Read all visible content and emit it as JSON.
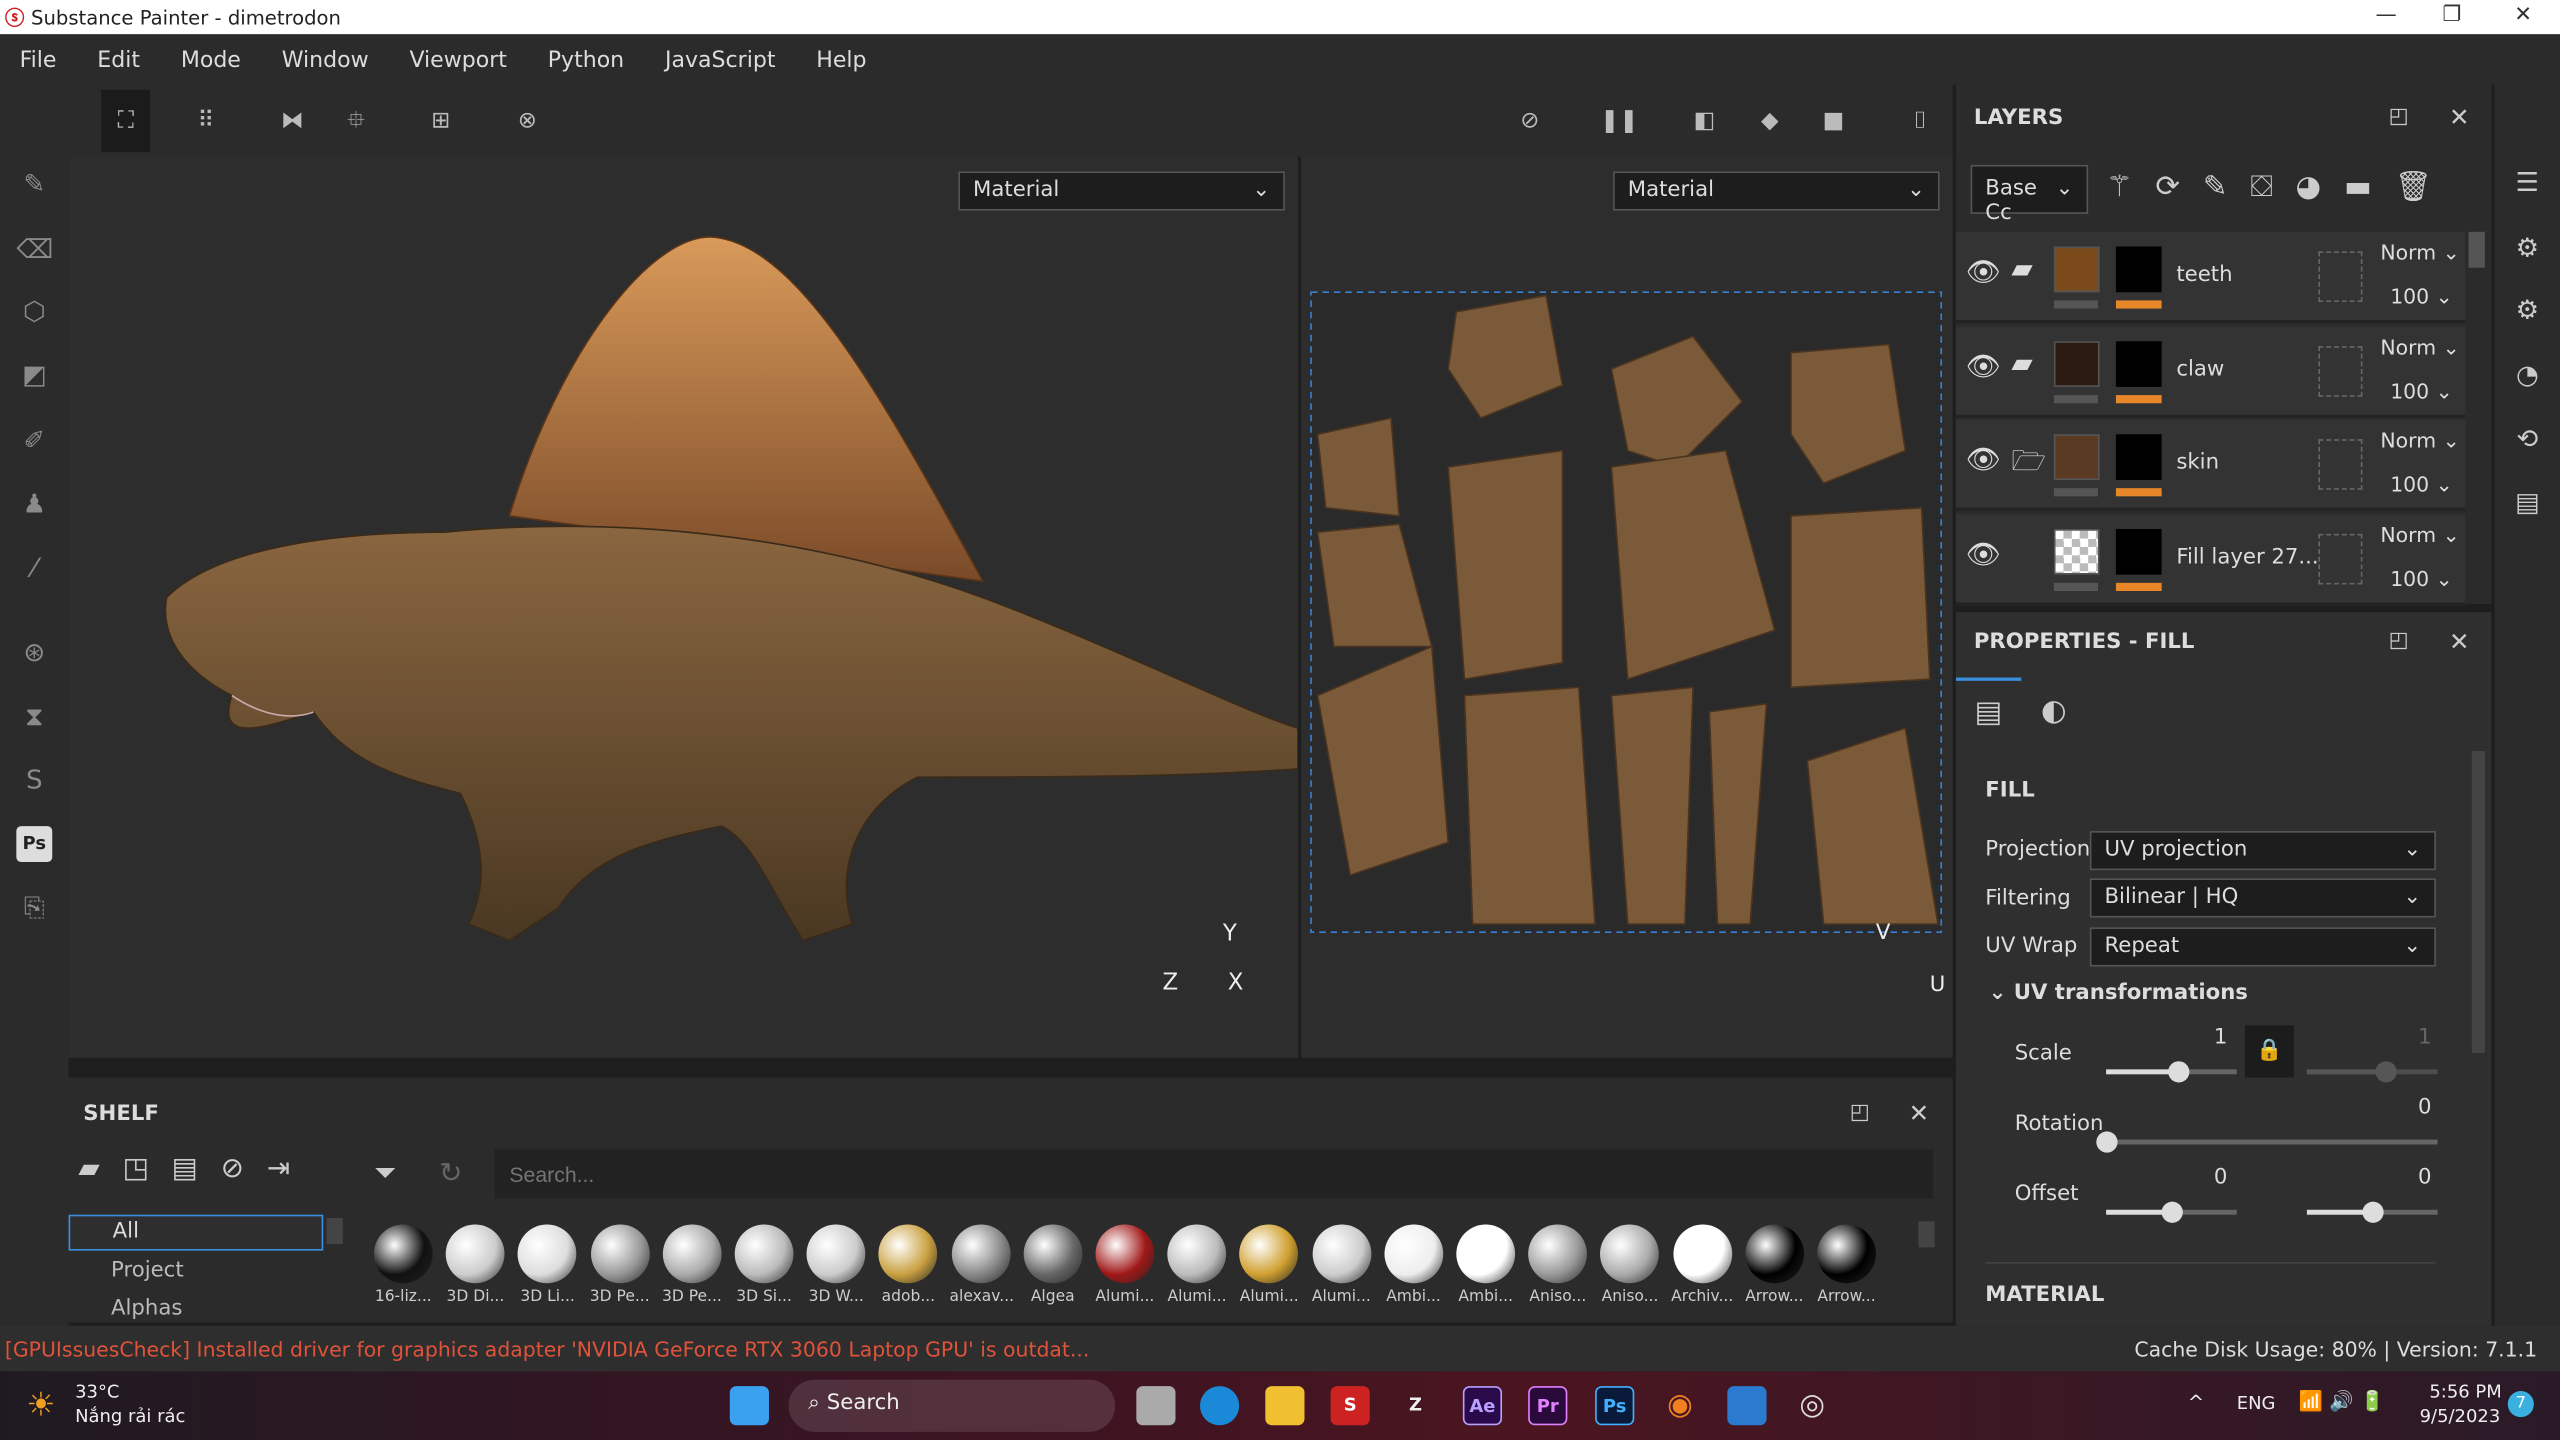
{
  "window": {
    "title": "Substance Painter - dimetrodon",
    "minimize": "—",
    "maximize": "❐",
    "close": "✕"
  },
  "menu": [
    "File",
    "Edit",
    "Mode",
    "Window",
    "Viewport",
    "Python",
    "JavaScript",
    "Help"
  ],
  "viewport": {
    "left_mode": "Material",
    "right_mode": "Material",
    "axes3d": {
      "y": "Y",
      "z": "Z",
      "x": "X"
    },
    "axes2d": {
      "v": "V",
      "u": "U"
    }
  },
  "layers": {
    "title": "LAYERS",
    "channel": "Base Cc",
    "rows": [
      {
        "name": "teeth",
        "blend": "Norm",
        "opacity": "100",
        "thumb": "#7a4a1a",
        "type": "folder"
      },
      {
        "name": "claw",
        "blend": "Norm",
        "opacity": "100",
        "thumb": "#2a1a10",
        "type": "folder"
      },
      {
        "name": "skin",
        "blend": "Norm",
        "opacity": "100",
        "thumb": "#5a3a22",
        "type": "folder-open"
      },
      {
        "name": "Fill layer 27...",
        "blend": "Norm",
        "opacity": "100",
        "thumb": "checker",
        "type": "fill"
      }
    ]
  },
  "properties": {
    "title": "PROPERTIES - FILL",
    "section": "FILL",
    "projection_label": "Projection",
    "projection": "UV projection",
    "filtering_label": "Filtering",
    "filtering": "Bilinear | HQ",
    "uvwrap_label": "UV Wrap",
    "uvwrap": "Repeat",
    "uvtrans": "UV transformations",
    "scale_label": "Scale",
    "scale_u": "1",
    "scale_v": "1",
    "rotation_label": "Rotation",
    "rotation": "0",
    "offset_label": "Offset",
    "offset_u": "0",
    "offset_v": "0",
    "material": "MATERIAL",
    "sliders": {
      "scale_u": 0.55,
      "scale_v": 0.6,
      "rotation": 0.0,
      "offset_u": 0.5,
      "offset_v": 0.5
    }
  },
  "shelf": {
    "title": "SHELF",
    "search_placeholder": "Search...",
    "categories": [
      "All",
      "Project",
      "Alphas"
    ],
    "items": [
      "16-liz...",
      "3D Di...",
      "3D Li...",
      "3D Pe...",
      "3D Pe...",
      "3D Si...",
      "3D W...",
      "adob...",
      "alexav...",
      "Algea",
      "Alumi...",
      "Alumi...",
      "Alumi...",
      "Alumi...",
      "Ambi...",
      "Ambi...",
      "Aniso...",
      "Aniso...",
      "Archiv...",
      "Arrow...",
      "Arrow..."
    ]
  },
  "status": {
    "message": "[GPUIssuesCheck] Installed driver for graphics adapter 'NVIDIA GeForce RTX 3060 Laptop GPU' is outdat...",
    "cache": "Cache Disk Usage: 80% | Version: 7.1.1",
    "error_color": "#e0533a"
  },
  "taskbar": {
    "temp": "33°C",
    "weather": "Nắng rải rác",
    "search": "Search",
    "apps": [
      "Ae",
      "Pr",
      "Ps"
    ],
    "lang": "ENG",
    "time": "5:56 PM",
    "date": "9/5/2023",
    "badge": "7"
  }
}
